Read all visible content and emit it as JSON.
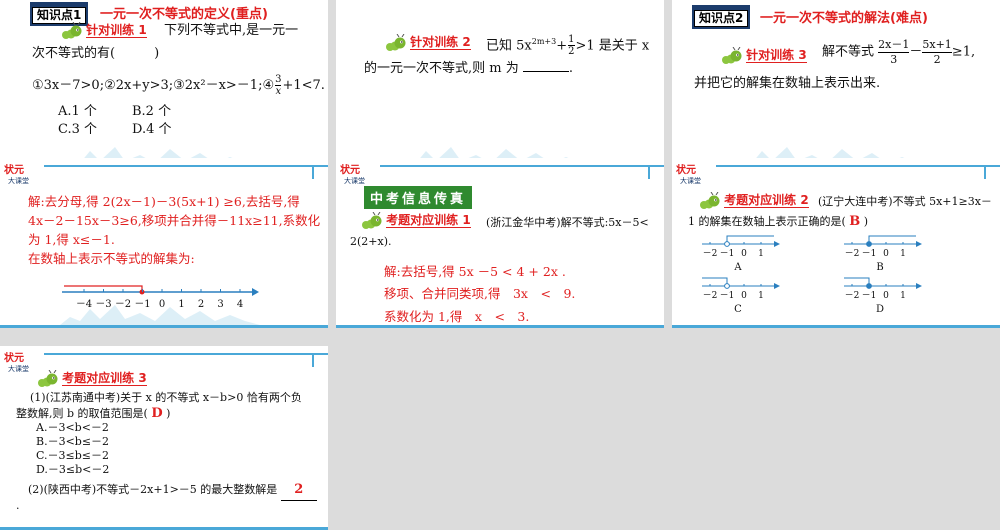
{
  "panel1": {
    "kp_label": "知识点1",
    "kp_title": "一元一次不等式的定义(重点)",
    "train_title": "针对训练 1",
    "q_line1": "下列不等式中,是一元一",
    "q_line2": "次不等式的有(　　　)",
    "options_line": "①3x－7>0;②2x+y>3;③2x²－x>－1;④",
    "frac_num": "3",
    "frac_den": "x",
    "options_tail": "+1<7.",
    "choice_a": "A.1 个",
    "choice_b": "B.2 个",
    "choice_c": "C.3 个",
    "choice_d": "D.4 个"
  },
  "panel2": {
    "train_title": "针对训练 2",
    "q_prefix": "已知 5x",
    "q_exp": "2m+3",
    "q_plus": "+",
    "frac_num": "1",
    "frac_den": "2",
    "q_suffix": ">1 是关于 x",
    "q_line2": "的一元一次不等式,则 m 为",
    "q_end": "."
  },
  "panel3": {
    "kp_label": "知识点2",
    "kp_title": "一元一次不等式的解法(难点)",
    "train_title": "针对训练 3",
    "q_prefix": "解不等式",
    "f1_num": "2x－1",
    "f1_den": "3",
    "minus": "－",
    "f2_num": "5x+1",
    "f2_den": "2",
    "q_suffix": "≥1,",
    "q_line2": "并把它的解集在数轴上表示出来."
  },
  "panel4": {
    "line1": "解:去分母,得 2(2x－1)－3(5x+1) ≥6,去括号,得",
    "line2": "4x－2－15x－3≥6,移项并合并得－11x≥11,系数化",
    "line3": "为 1,得 x≤－1.",
    "line4": "在数轴上表示不等式的解集为:",
    "ticks": [
      "－4",
      "－3",
      "－2",
      "－1",
      "0",
      "1",
      "2",
      "3",
      "4"
    ]
  },
  "panel5": {
    "banner": "中考信息传真",
    "train_title": "考题对应训练 1",
    "q_line1": "(浙江金华中考)解不等式:5x－5<",
    "q_line2": "2(2+x).",
    "a_line1": "解:去括号,得 5x －5 < 4 + 2x .",
    "a_line2": "移项、合并同类项,得　3x　<　9.",
    "a_line3": "系数化为 1,得　x　<　3."
  },
  "panel6": {
    "train_title": "考题对应训练 2",
    "q_line1": "(辽宁大连中考)不等式 5x+1≥3x－",
    "q_line2": "1 的解集在数轴上表示正确的是(",
    "answer": "B",
    "q_close": ")",
    "axis_ticks": [
      "－2",
      "－1",
      "0",
      "1"
    ],
    "labels": [
      "A",
      "B",
      "C",
      "D"
    ]
  },
  "panel7": {
    "train_title": "考题对应训练 3",
    "q1_line1": "(1)(江苏南通中考)关于 x 的不等式 x－b>0 恰有两个负",
    "q1_line2": "整数解,则 b 的取值范围是(",
    "q1_answer": "D",
    "q1_close": ")",
    "opt_a": "A.－3<b<－2",
    "opt_b": "B.－3<b≤－2",
    "opt_c": "C.－3≤b≤－2",
    "opt_d": "D.－3≤b<－2",
    "q2": "(2)(陕西中考)不等式－2x+1>－5 的最大整数解是",
    "q2_answer": "2",
    "q2_end": "."
  },
  "colors": {
    "red": "#e02020",
    "blue": "#4aa8d8",
    "green": "#2f8a2f",
    "navy": "#1c3c6c"
  }
}
